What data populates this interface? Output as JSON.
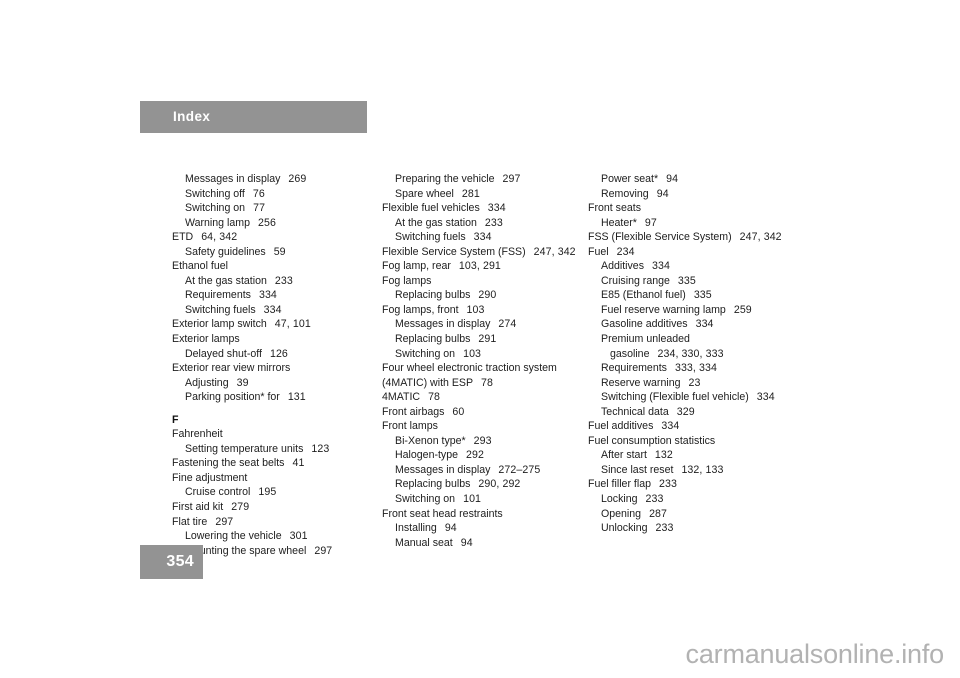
{
  "page": {
    "section_title": "Index",
    "page_number": "354",
    "watermark": "carmanualsonline.info",
    "accent_gray": "#939393",
    "text_color": "#1d1d1d",
    "watermark_color": "#b2b2b2",
    "background": "#ffffff"
  },
  "columns": [
    {
      "id": "column-1",
      "entries": [
        {
          "level": 1,
          "term": "Messages in display",
          "pages": "269"
        },
        {
          "level": 1,
          "term": "Switching off",
          "pages": "76"
        },
        {
          "level": 1,
          "term": "Switching on",
          "pages": "77"
        },
        {
          "level": 1,
          "term": "Warning lamp",
          "pages": "256"
        },
        {
          "level": 0,
          "term": "ETD",
          "pages": "64, 342"
        },
        {
          "level": 1,
          "term": "Safety guidelines",
          "pages": "59"
        },
        {
          "level": 0,
          "term": "Ethanol fuel",
          "pages": ""
        },
        {
          "level": 1,
          "term": "At the gas station",
          "pages": "233"
        },
        {
          "level": 1,
          "term": "Requirements",
          "pages": "334"
        },
        {
          "level": 1,
          "term": "Switching fuels",
          "pages": "334"
        },
        {
          "level": 0,
          "term": "Exterior lamp switch",
          "pages": "47, 101"
        },
        {
          "level": 0,
          "term": "Exterior lamps",
          "pages": ""
        },
        {
          "level": 1,
          "term": "Delayed shut-off",
          "pages": "126"
        },
        {
          "level": 0,
          "term": "Exterior rear view mirrors",
          "pages": ""
        },
        {
          "level": 1,
          "term": "Adjusting",
          "pages": "39"
        },
        {
          "level": 1,
          "term": "Parking position* for",
          "pages": "131"
        },
        {
          "heading": "F"
        },
        {
          "level": 0,
          "term": "Fahrenheit",
          "pages": ""
        },
        {
          "level": 1,
          "term": "Setting temperature units",
          "pages": "123"
        },
        {
          "level": 0,
          "term": "Fastening the seat belts",
          "pages": "41"
        },
        {
          "level": 0,
          "term": "Fine adjustment",
          "pages": ""
        },
        {
          "level": 1,
          "term": "Cruise control",
          "pages": "195"
        },
        {
          "level": 0,
          "term": "First aid kit",
          "pages": "279"
        },
        {
          "level": 0,
          "term": "Flat tire",
          "pages": "297"
        },
        {
          "level": 1,
          "term": "Lowering the vehicle",
          "pages": "301"
        },
        {
          "level": 1,
          "term": "Mounting the spare wheel",
          "pages": "297"
        }
      ]
    },
    {
      "id": "column-2",
      "entries": [
        {
          "level": 1,
          "term": "Preparing the vehicle",
          "pages": "297"
        },
        {
          "level": 1,
          "term": "Spare wheel",
          "pages": "281"
        },
        {
          "level": 0,
          "term": "Flexible fuel vehicles",
          "pages": "334"
        },
        {
          "level": 1,
          "term": "At the gas station",
          "pages": "233"
        },
        {
          "level": 1,
          "term": "Switching fuels",
          "pages": "334"
        },
        {
          "level": 0,
          "term": "Flexible Service System (FSS)",
          "pages": "247, 342"
        },
        {
          "level": 0,
          "term": "Fog lamp, rear",
          "pages": "103, 291"
        },
        {
          "level": 0,
          "term": "Fog lamps",
          "pages": ""
        },
        {
          "level": 1,
          "term": "Replacing bulbs",
          "pages": "290"
        },
        {
          "level": 0,
          "term": "Fog lamps, front",
          "pages": "103"
        },
        {
          "level": 1,
          "term": "Messages in display",
          "pages": "274"
        },
        {
          "level": 1,
          "term": "Replacing bulbs",
          "pages": "291"
        },
        {
          "level": 1,
          "term": "Switching on",
          "pages": "103"
        },
        {
          "level": 0,
          "term": "Four wheel electronic traction system",
          "pages": ""
        },
        {
          "level": "cont",
          "term": "(4MATIC) with ESP",
          "pages": "78"
        },
        {
          "level": 0,
          "term": "4MATIC",
          "pages": "78"
        },
        {
          "level": 0,
          "term": "Front airbags",
          "pages": "60"
        },
        {
          "level": 0,
          "term": "Front lamps",
          "pages": ""
        },
        {
          "level": 1,
          "term": "Bi-Xenon type*",
          "pages": "293"
        },
        {
          "level": 1,
          "term": "Halogen-type",
          "pages": "292"
        },
        {
          "level": 1,
          "term": "Messages in display",
          "pages": "272–275"
        },
        {
          "level": 1,
          "term": "Replacing bulbs",
          "pages": "290, 292"
        },
        {
          "level": 1,
          "term": "Switching on",
          "pages": "101"
        },
        {
          "level": 0,
          "term": "Front seat head restraints",
          "pages": ""
        },
        {
          "level": 1,
          "term": "Installing",
          "pages": "94"
        },
        {
          "level": 1,
          "term": "Manual seat",
          "pages": "94"
        }
      ]
    },
    {
      "id": "column-3",
      "entries": [
        {
          "level": 1,
          "term": "Power seat*",
          "pages": "94"
        },
        {
          "level": 1,
          "term": "Removing",
          "pages": "94"
        },
        {
          "level": 0,
          "term": "Front seats",
          "pages": ""
        },
        {
          "level": 1,
          "term": "Heater*",
          "pages": "97"
        },
        {
          "level": 0,
          "term": "FSS (Flexible Service System)",
          "pages": "247, 342"
        },
        {
          "level": 0,
          "term": "Fuel",
          "pages": "234"
        },
        {
          "level": 1,
          "term": "Additives",
          "pages": "334"
        },
        {
          "level": 1,
          "term": "Cruising range",
          "pages": "335"
        },
        {
          "level": 1,
          "term": "E85 (Ethanol fuel)",
          "pages": "335"
        },
        {
          "level": 1,
          "term": "Fuel reserve warning lamp",
          "pages": "259"
        },
        {
          "level": 1,
          "term": "Gasoline additives",
          "pages": "334"
        },
        {
          "level": 1,
          "term": "Premium unleaded",
          "pages": ""
        },
        {
          "level": 2,
          "term": "gasoline",
          "pages": "234, 330, 333"
        },
        {
          "level": 1,
          "term": "Requirements",
          "pages": "333, 334"
        },
        {
          "level": 1,
          "term": "Reserve warning",
          "pages": "23"
        },
        {
          "level": 1,
          "term": "Switching (Flexible fuel vehicle)",
          "pages": "334"
        },
        {
          "level": 1,
          "term": "Technical data",
          "pages": "329"
        },
        {
          "level": 0,
          "term": "Fuel additives",
          "pages": "334"
        },
        {
          "level": 0,
          "term": "Fuel consumption statistics",
          "pages": ""
        },
        {
          "level": 1,
          "term": "After start",
          "pages": "132"
        },
        {
          "level": 1,
          "term": "Since last reset",
          "pages": "132, 133"
        },
        {
          "level": 0,
          "term": "Fuel filler flap",
          "pages": "233"
        },
        {
          "level": 1,
          "term": "Locking",
          "pages": "233"
        },
        {
          "level": 1,
          "term": "Opening",
          "pages": "287"
        },
        {
          "level": 1,
          "term": "Unlocking",
          "pages": "233"
        }
      ]
    }
  ]
}
